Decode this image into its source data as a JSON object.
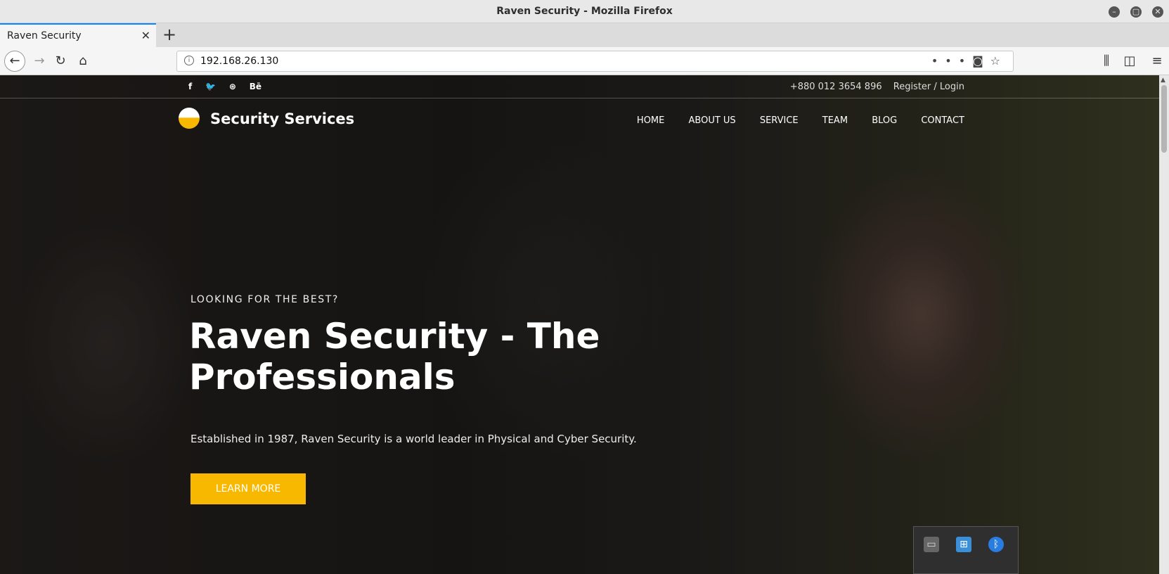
{
  "window": {
    "title": "Raven Security - Mozilla Firefox"
  },
  "tab": {
    "label": "Raven Security",
    "close": "✕"
  },
  "newtab": "+",
  "url": "192.168.26.130",
  "topbar": {
    "social": [
      "f",
      "🐦",
      "⊛",
      "Bē"
    ],
    "phone": "+880 012 3654 896",
    "login": "Register / Login"
  },
  "brand": {
    "name": "Security Services"
  },
  "menu": [
    "HOME",
    "ABOUT US",
    "SERVICE",
    "TEAM",
    "BLOG",
    "CONTACT"
  ],
  "hero": {
    "kicker": "LOOKING FOR THE BEST?",
    "title": "Raven Security - The Professionals",
    "desc": "Established in 1987, Raven Security is a world leader in Physical and Cyber Security.",
    "button": "LEARN MORE"
  },
  "colors": {
    "accent": "#f8b800",
    "tab_highlight": "#0a84ff"
  }
}
